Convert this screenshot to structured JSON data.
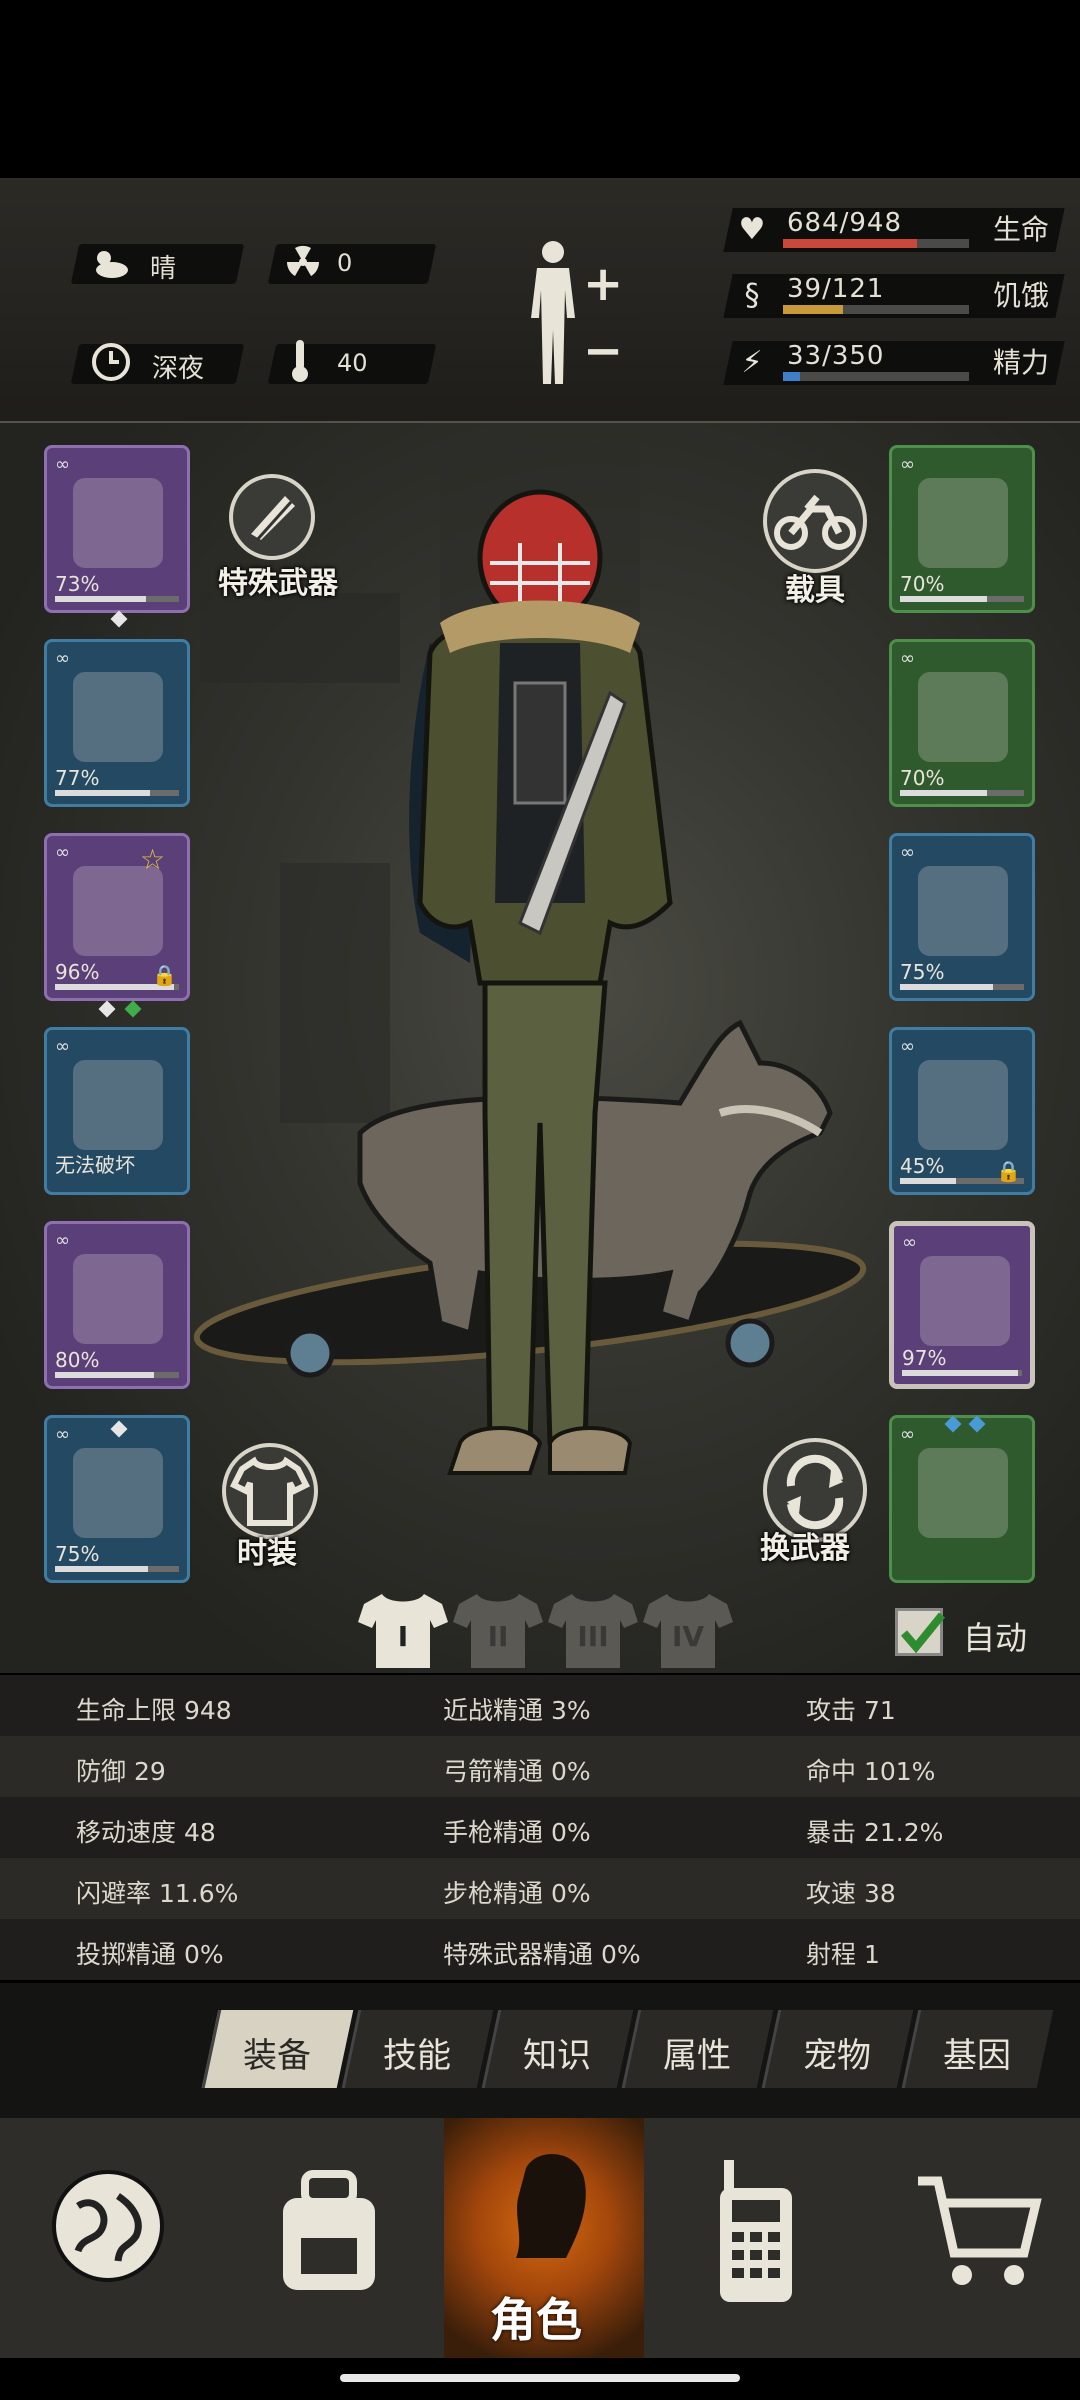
{
  "status": {
    "weather": "晴",
    "radiation": "0",
    "time_of_day": "深夜",
    "temperature": "40"
  },
  "vitals": [
    {
      "value": "684/948",
      "name": "生命",
      "fraction": 0.72,
      "color": "#c9473b",
      "icon": "heart-icon"
    },
    {
      "value": "39/121",
      "name": "饥饿",
      "fraction": 0.32,
      "color": "#c99a3a",
      "icon": "stomach-icon"
    },
    {
      "value": "33/350",
      "name": "精力",
      "fraction": 0.09,
      "color": "#3f7fc9",
      "icon": "energy-icon"
    }
  ],
  "left_slots": [
    {
      "item": "helmet-icon",
      "pct": "73%",
      "rarity": "purple",
      "fraction": 0.73
    },
    {
      "item": "shirt-icon",
      "pct": "77%",
      "rarity": "blue",
      "fraction": 0.77
    },
    {
      "item": "jacket-icon",
      "pct": "96%",
      "rarity": "purple",
      "fraction": 0.96
    },
    {
      "item": "backpack-icon",
      "pct": "无法破坏",
      "rarity": "blue",
      "fraction": 0
    },
    {
      "item": "pants-icon",
      "pct": "80%",
      "rarity": "purple",
      "fraction": 0.8
    },
    {
      "item": "shoes-icon",
      "pct": "75%",
      "rarity": "blue",
      "fraction": 0.75
    }
  ],
  "right_slots": [
    {
      "item": "glasses-icon",
      "pct": "70%",
      "rarity": "green",
      "fraction": 0.7
    },
    {
      "item": "mask-icon",
      "pct": "70%",
      "rarity": "green",
      "fraction": 0.7
    },
    {
      "item": "vest-icon",
      "pct": "75%",
      "rarity": "blue",
      "fraction": 0.75
    },
    {
      "item": "shield-icon",
      "pct": "45%",
      "rarity": "blue",
      "fraction": 0.45
    },
    {
      "item": "machete-icon",
      "pct": "97%",
      "rarity": "selected",
      "fraction": 0.97
    },
    {
      "item": "spear-icon",
      "pct": "",
      "rarity": "green",
      "fraction": 0
    }
  ],
  "buttons": {
    "special_weapon": "特殊武器",
    "vehicle": "载具",
    "fashion": "时装",
    "swap_weapon": "换武器",
    "auto": "自动"
  },
  "loadout_tabs": [
    "I",
    "II",
    "III",
    "IV"
  ],
  "stats": [
    [
      "生命上限 948",
      "近战精通 3%",
      "攻击 71"
    ],
    [
      "防御 29",
      "弓箭精通 0%",
      "命中 101%"
    ],
    [
      "移动速度 48",
      "手枪精通 0%",
      "暴击 21.2%"
    ],
    [
      "闪避率 11.6%",
      "步枪精通 0%",
      "攻速 38"
    ],
    [
      "投掷精通 0%",
      "特殊武器精通 0%",
      "射程 1"
    ]
  ],
  "tabs": [
    "装备",
    "技能",
    "知识",
    "属性",
    "宠物",
    "基因"
  ],
  "nav": [
    {
      "icon": "globe-icon",
      "label": ""
    },
    {
      "icon": "backpack-icon",
      "label": ""
    },
    {
      "icon": "character-icon",
      "label": "角色"
    },
    {
      "icon": "radio-icon",
      "label": ""
    },
    {
      "icon": "cart-icon",
      "label": ""
    }
  ]
}
